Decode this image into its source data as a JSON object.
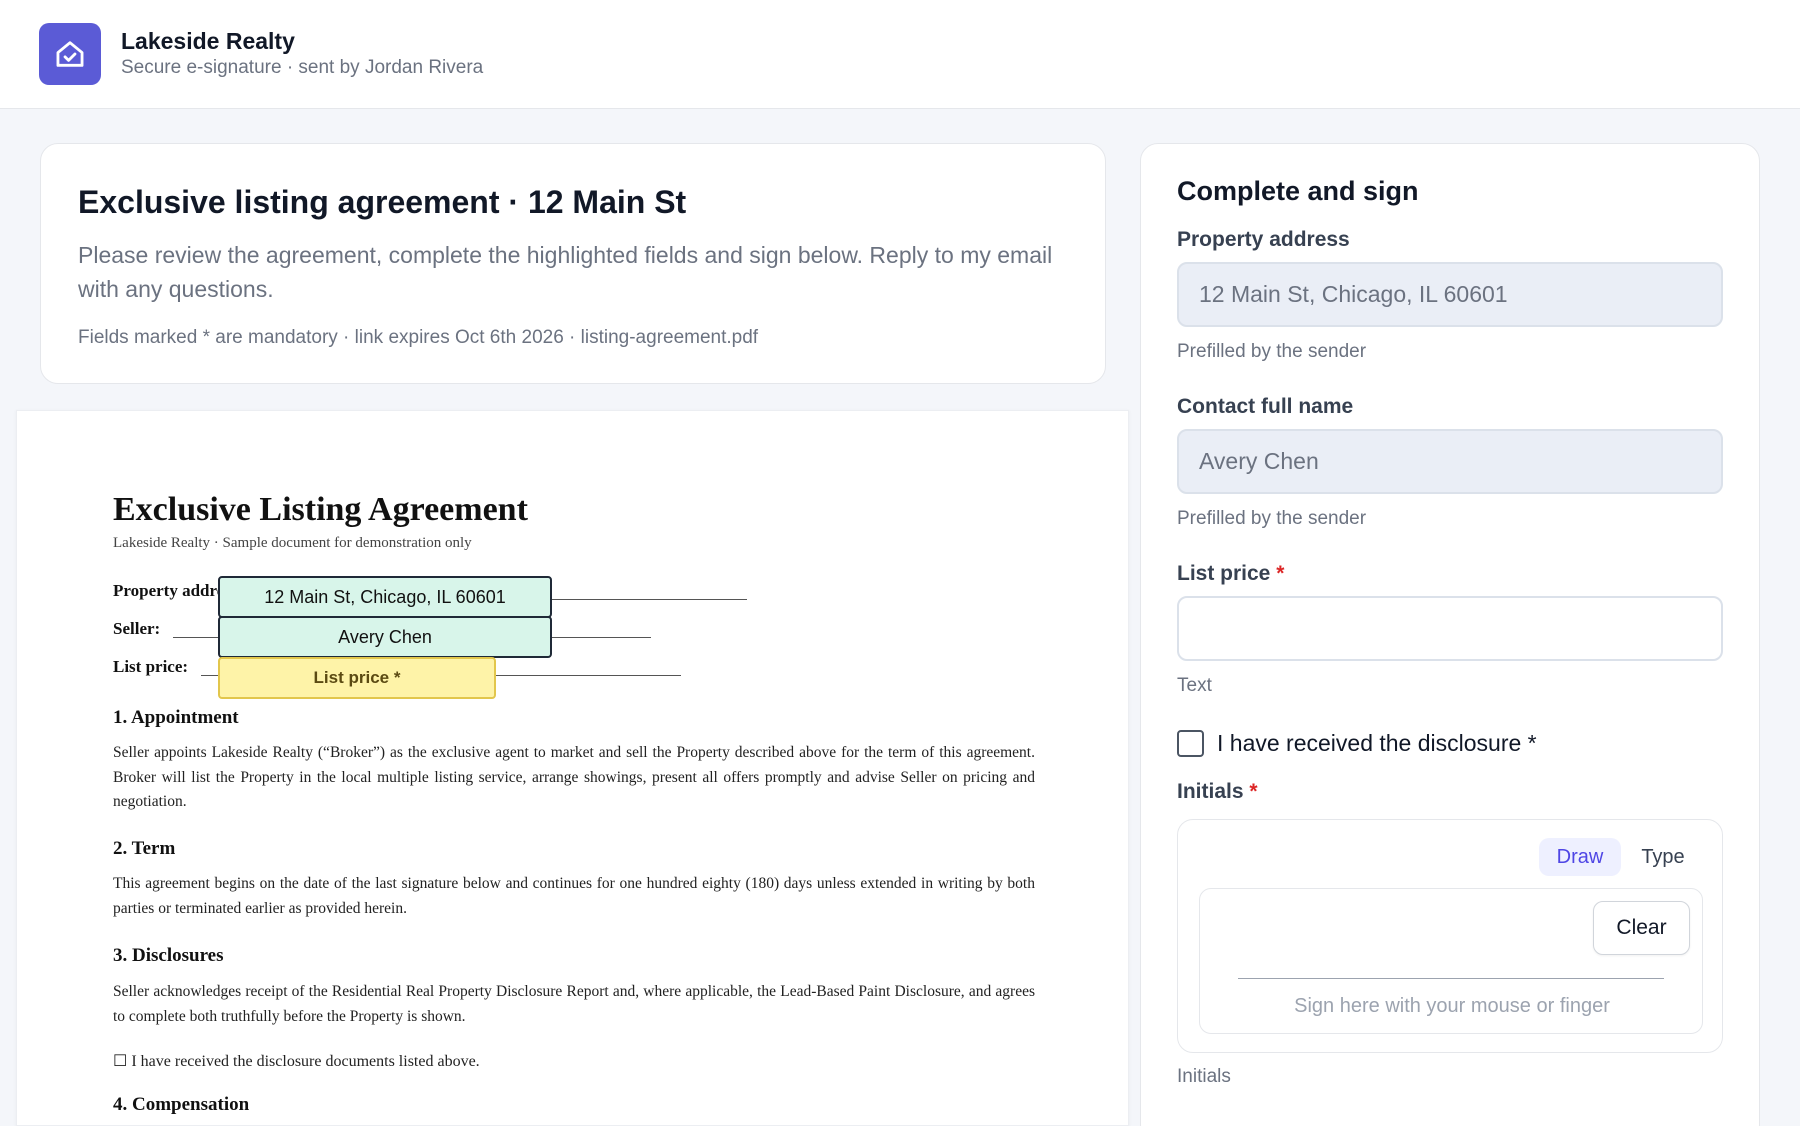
{
  "app": {
    "brand_name": "Lakeside Realty",
    "brand_sub": "Secure e-signature · sent by Jordan Rivera",
    "logo_icon": "house-shield-icon",
    "accent_color": "#5b5bd6"
  },
  "intro": {
    "title": "Exclusive listing agreement · 12 Main St",
    "description": "Please review the agreement, complete the highlighted fields and sign below. Reply to my email with any questions.",
    "meta": "Fields marked * are mandatory · link expires Oct 6th 2026 · listing-agreement.pdf"
  },
  "document": {
    "title": "Exclusive Listing Agreement",
    "subtitle": "Lakeside Realty · Sample document for demonstration only",
    "fields": [
      {
        "label": "Property address:",
        "overlay": "12 Main St, Chicago, IL 60601",
        "state": "filled"
      },
      {
        "label": "Seller:",
        "overlay": "Avery Chen",
        "state": "filled"
      },
      {
        "label": "List price:",
        "overlay": "List price *",
        "state": "empty"
      }
    ],
    "sections": [
      {
        "heading": "1. Appointment",
        "body": "Seller appoints Lakeside Realty (“Broker”) as the exclusive agent to market and sell the Property described above for the term of this agreement. Broker will list the Property in the local multiple listing service, arrange showings, present all offers promptly and advise Seller on pricing and negotiation."
      },
      {
        "heading": "2. Term",
        "body": "This agreement begins on the date of the last signature below and continues for one hundred eighty (180) days unless extended in writing by both parties or terminated earlier as provided herein."
      },
      {
        "heading": "3. Disclosures",
        "body": "Seller acknowledges receipt of the Residential Real Property Disclosure Report and, where applicable, the Lead-Based Paint Disclosure, and agrees to complete both truthfully before the Property is shown."
      },
      {
        "heading": "4. Compensation",
        "body": ""
      }
    ],
    "checkbox_line": "☐ I have received the disclosure documents listed above."
  },
  "panel": {
    "title": "Complete and sign",
    "property_address": {
      "label": "Property address",
      "value": "12 Main St, Chicago, IL 60601",
      "hint": "Prefilled by the sender"
    },
    "contact_name": {
      "label": "Contact full name",
      "value": "Avery Chen",
      "hint": "Prefilled by the sender"
    },
    "list_price": {
      "label": "List price",
      "required_mark": "*",
      "value": "",
      "placeholder": "",
      "hint": "Text"
    },
    "disclosure_checkbox": {
      "label": "I have received the disclosure *",
      "checked": false
    },
    "initials": {
      "label": "Initials",
      "required_mark": "*",
      "mode_draw": "Draw",
      "mode_type": "Type",
      "active_mode": "Draw",
      "clear_label": "Clear",
      "pad_hint": "Sign here with your mouse or finger",
      "hint": "Initials"
    }
  }
}
